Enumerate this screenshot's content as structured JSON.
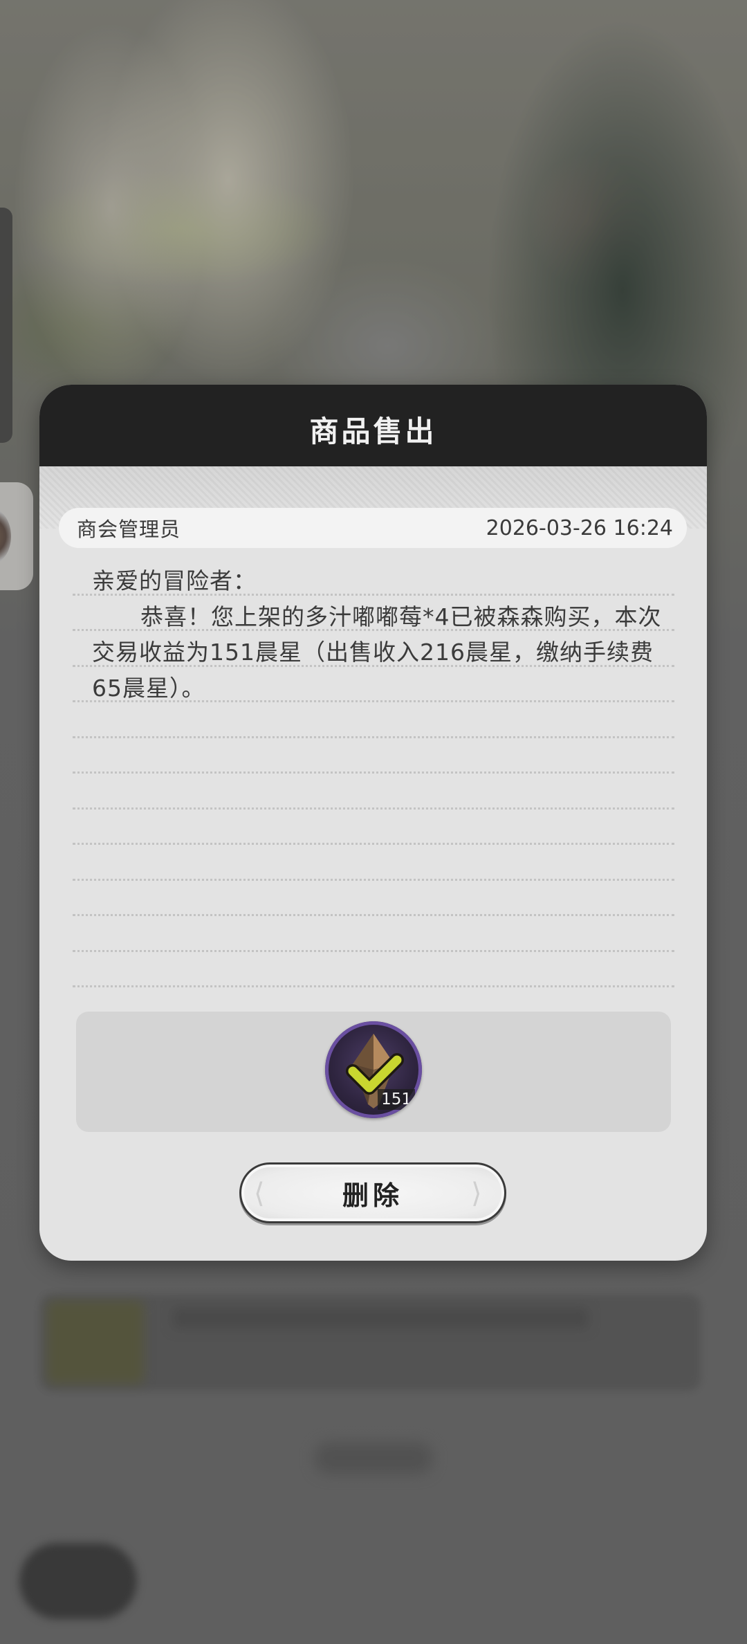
{
  "dialog": {
    "title": "商品售出",
    "sender": "商会管理员",
    "timestamp": "2026-03-26 16:24",
    "greeting": "亲爱的冒险者：",
    "body": "恭喜！您上架的多汁嘟嘟莓*4已被森森购买，本次交易收益为151晨星（出售收入216晨星，缴纳手续费65晨星）。",
    "reward": {
      "icon": "star-crystal-icon",
      "count": "151"
    },
    "delete_label": "删除"
  },
  "colors": {
    "header_bg": "#222222",
    "panel_bg": "#e3e3e3",
    "reward_ring": "#6a4fa1",
    "reward_check": "#c9d630"
  }
}
